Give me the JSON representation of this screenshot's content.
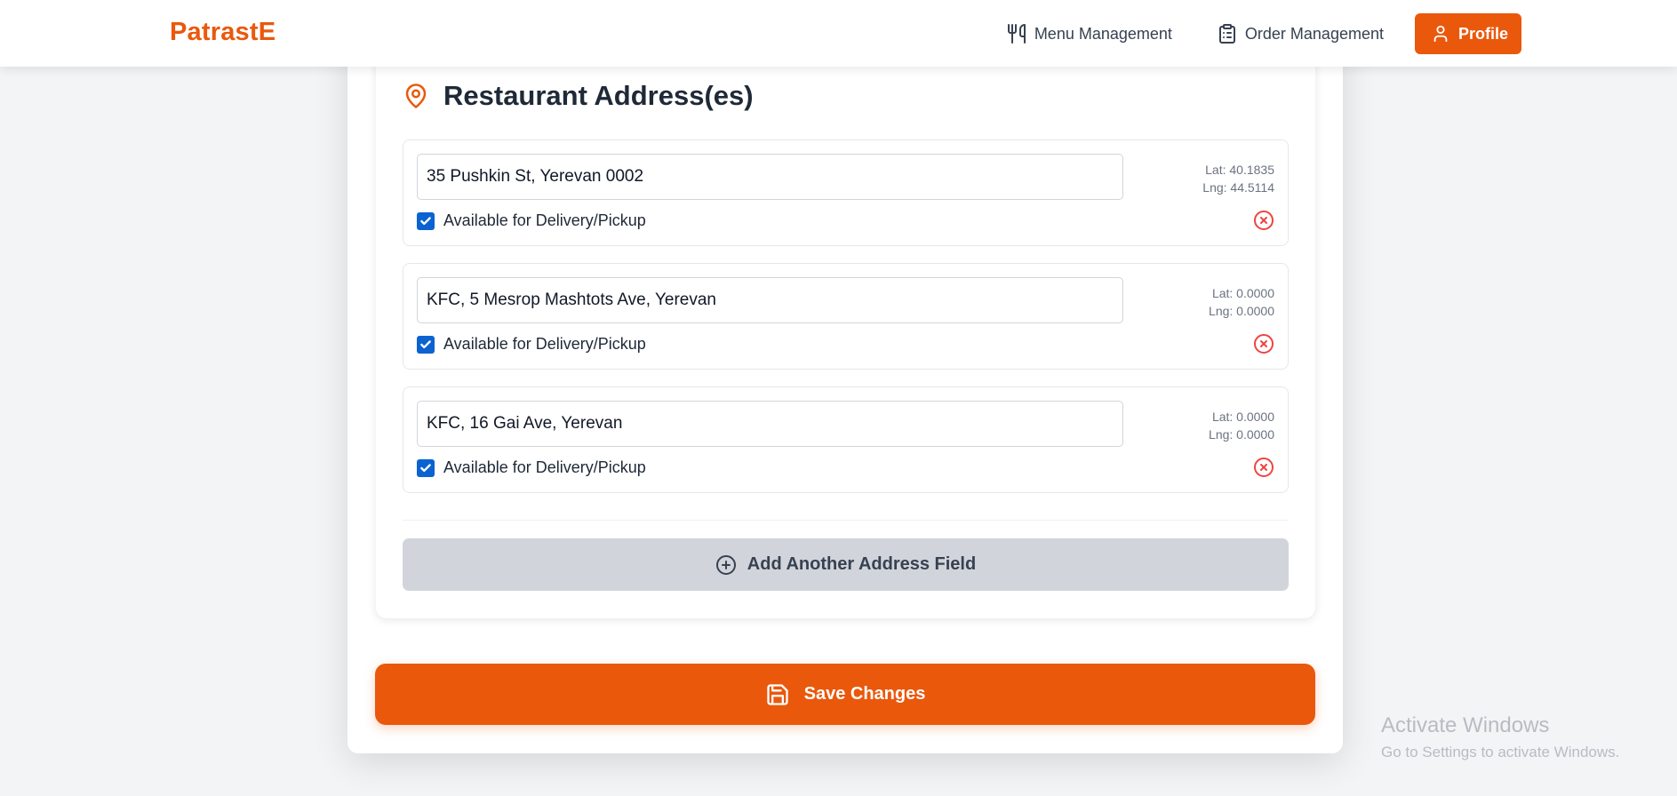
{
  "header": {
    "brand": "PatrastE",
    "nav": {
      "menu_management": "Menu Management",
      "order_management": "Order Management",
      "profile": "Profile"
    },
    "accent_color": "#ea580c"
  },
  "section": {
    "title": "Restaurant Address(es)",
    "icon": "map-pin-icon"
  },
  "addresses": [
    {
      "value": "35 Pushkin St, Yerevan 0002",
      "lat": "Lat: 40.1835",
      "lng": "Lng: 44.5114",
      "available_label": "Available for Delivery/Pickup",
      "available": true
    },
    {
      "value": "KFC, 5 Mesrop Mashtots Ave, Yerevan",
      "lat": "Lat: 0.0000",
      "lng": "Lng: 0.0000",
      "available_label": "Available for Delivery/Pickup",
      "available": true
    },
    {
      "value": "KFC, 16 Gai Ave, Yerevan",
      "lat": "Lat: 0.0000",
      "lng": "Lng: 0.0000",
      "available_label": "Available for Delivery/Pickup",
      "available": true
    }
  ],
  "add_address_label": "Add Another Address Field",
  "save_label": "Save Changes",
  "watermark": {
    "line1": "Activate Windows",
    "line2": "Go to Settings to activate Windows."
  }
}
